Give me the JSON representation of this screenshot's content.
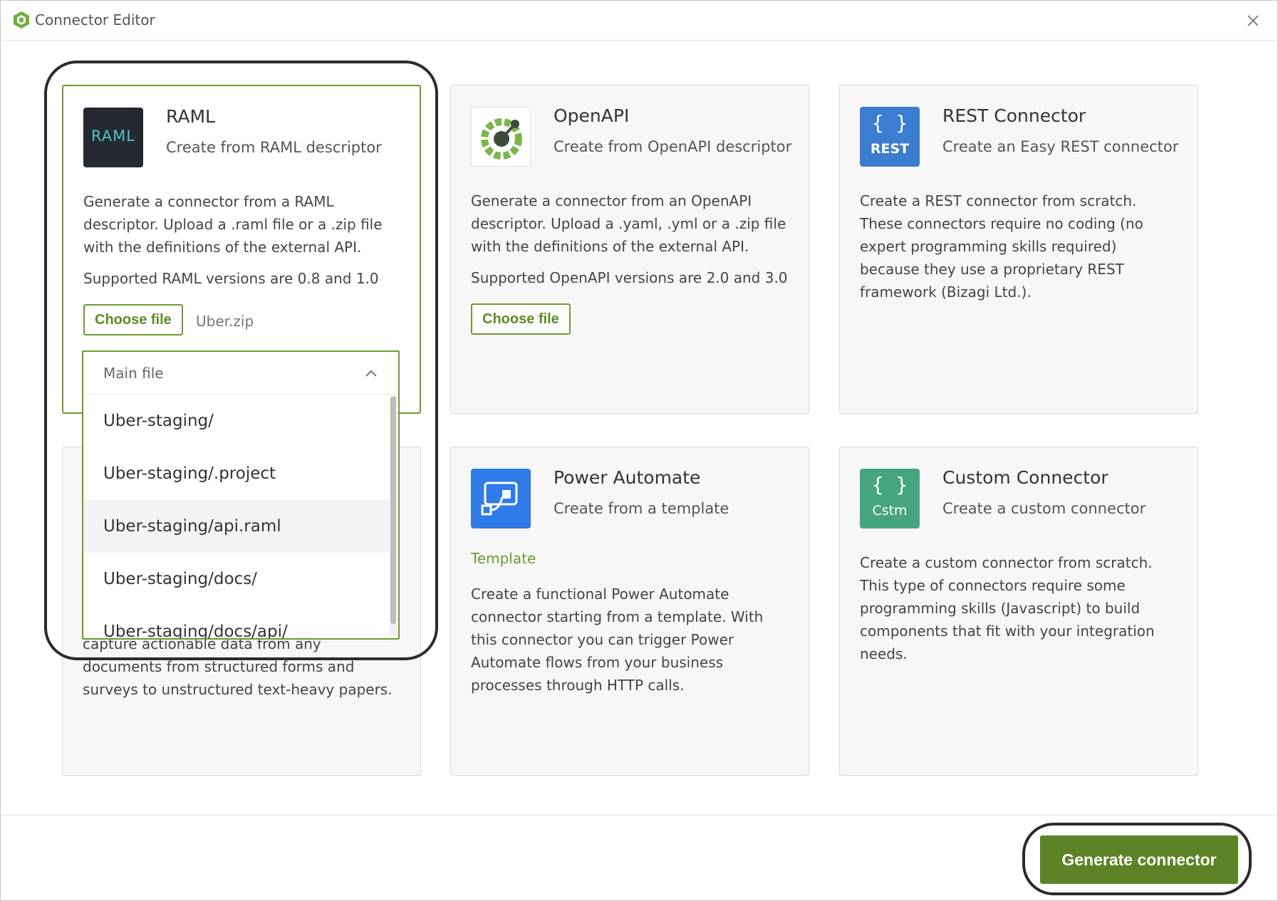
{
  "window": {
    "title": "Connector Editor"
  },
  "cards": {
    "raml": {
      "title": "RAML",
      "subtitle": "Create from RAML descriptor",
      "icon_label": "RAML",
      "description": "Generate a connector from a RAML descriptor. Upload a .raml file or a .zip file with the definitions of the external API.",
      "versions": "Supported RAML versions are 0.8 and 1.0",
      "choose_file_label": "Choose file",
      "selected_file": "Uber.zip"
    },
    "openapi": {
      "title": "OpenAPI",
      "subtitle": "Create from OpenAPI descriptor",
      "description": "Generate a connector from an OpenAPI descriptor. Upload a .yaml, .yml or a .zip file with the definitions of the external API.",
      "versions": "Supported OpenAPI versions are 2.0 and 3.0",
      "choose_file_label": "Choose file"
    },
    "rest": {
      "title": "REST Connector",
      "subtitle": "Create an Easy REST connector",
      "icon_braces": "{ }",
      "icon_label": "REST",
      "description": "Create a REST connector from scratch. These connectors require no coding (no expert programming skills required) because they use a proprietary REST framework (Bizagi Ltd.)."
    },
    "document": {
      "description": "capture actionable data from any documents from structured forms and surveys to unstructured text-heavy papers."
    },
    "power_automate": {
      "title": "Power Automate",
      "subtitle": "Create from a template",
      "template_label": "Template",
      "description": "Create a functional Power Automate connector starting from a template. With this connector you can trigger Power Automate flows from your business processes through HTTP calls."
    },
    "custom": {
      "title": "Custom Connector",
      "subtitle": "Create a custom connector",
      "icon_braces": "{ }",
      "icon_label": "Cstm",
      "description": "Create a custom connector from scratch. This type of connectors require some programming skills (Javascript) to build components that fit with your integration needs."
    }
  },
  "dropdown": {
    "header": "Main file",
    "items": [
      "Uber-staging/",
      "Uber-staging/.project",
      "Uber-staging/api.raml",
      "Uber-staging/docs/",
      "Uber-staging/docs/api/"
    ]
  },
  "footer": {
    "generate_label": "Generate connector"
  },
  "colors": {
    "accent_green": "#6f9a2f",
    "button_green": "#5c8426",
    "rest_blue": "#3b7dd0",
    "custom_teal": "#46a57e",
    "power_blue": "#2f7be8"
  }
}
